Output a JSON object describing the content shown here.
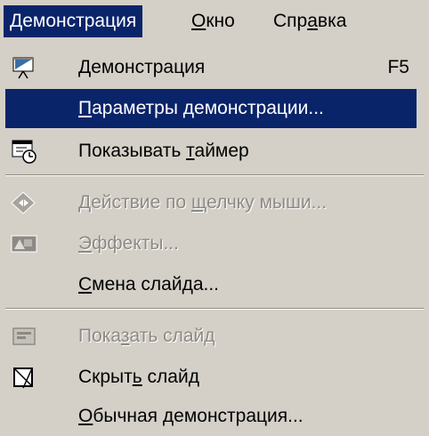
{
  "menubar": {
    "items": [
      {
        "label": "Демонстрация"
      },
      {
        "label_u": "О",
        "label_rest": "кно"
      },
      {
        "label_pre": "Спр",
        "label_u": "а",
        "label_post": "вка"
      }
    ]
  },
  "menu": {
    "show": {
      "label_u": "Д",
      "label_rest": "емонстрация",
      "shortcut": "F5",
      "icon": "slideshow-icon"
    },
    "settings": {
      "label_u": "П",
      "label_rest": "араметры демонстрации..."
    },
    "timer": {
      "label_pre": "Показывать ",
      "label_u": "т",
      "label_post": "аймер",
      "icon": "timer-icon"
    },
    "mouse_action": {
      "label_pre": "Действие по ",
      "label_u": "щ",
      "label_post": "елчку мыши...",
      "icon": "action-icon"
    },
    "effects": {
      "label_u": "Э",
      "label_rest": "ффекты...",
      "icon": "effects-icon"
    },
    "transition": {
      "label_u": "С",
      "label_rest": "мена слайда..."
    },
    "show_slide": {
      "label_pre": "Пока",
      "label_u": "з",
      "label_post": "ать слайд",
      "icon": "show-slide-icon"
    },
    "hide_slide": {
      "label_pre": "Скрыт",
      "label_u": "ь",
      "label_post": " слайд",
      "icon": "hide-slide-icon"
    },
    "normal_show": {
      "label_u": "О",
      "label_rest": "бычная демонстрация..."
    }
  },
  "colors": {
    "highlight": "#0a246a",
    "face": "#d4d0c8",
    "disabled": "#8d8a84"
  }
}
